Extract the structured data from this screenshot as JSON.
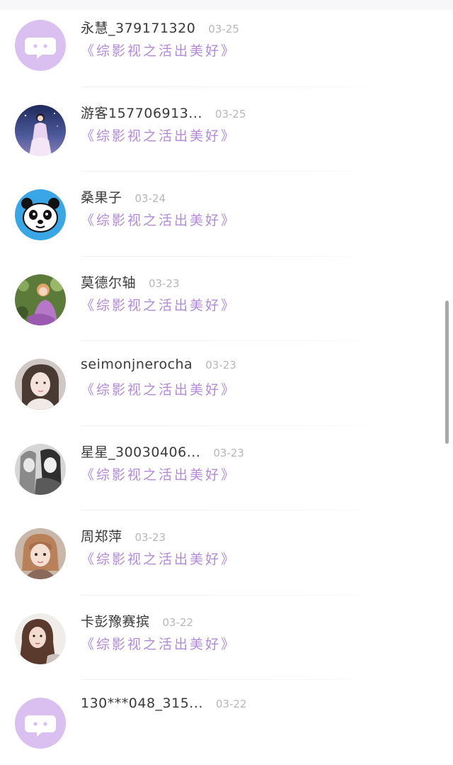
{
  "colors": {
    "accent_purple": "#b38ad8",
    "avatar_default_bg": "#d9c0f1",
    "name_text": "#3a3a3a",
    "date_text": "#b7b7b7"
  },
  "items": [
    {
      "name": "永慧_379171320",
      "date": "03-25",
      "work": "《综影视之活出美好》",
      "avatar_icon": "chat-bubble-icon"
    },
    {
      "name": "游客157706913...",
      "date": "03-25",
      "work": "《综影视之活出美好》",
      "avatar_icon": "user-photo"
    },
    {
      "name": "桑果子",
      "date": "03-24",
      "work": "《综影视之活出美好》",
      "avatar_icon": "panda-icon"
    },
    {
      "name": "莫德尔轴",
      "date": "03-23",
      "work": "《综影视之活出美好》",
      "avatar_icon": "user-photo"
    },
    {
      "name": "seimonjnerocha",
      "date": "03-23",
      "work": "《综影视之活出美好》",
      "avatar_icon": "user-photo"
    },
    {
      "name": "星星_30030406...",
      "date": "03-23",
      "work": "《综影视之活出美好》",
      "avatar_icon": "user-photo"
    },
    {
      "name": "周郑萍",
      "date": "03-23",
      "work": "《综影视之活出美好》",
      "avatar_icon": "user-photo"
    },
    {
      "name": "卡彭豫赛摈",
      "date": "03-22",
      "work": "《综影视之活出美好》",
      "avatar_icon": "user-photo"
    },
    {
      "name": "130***048_315...",
      "date": "03-22",
      "work": "",
      "avatar_icon": "chat-bubble-icon"
    }
  ]
}
